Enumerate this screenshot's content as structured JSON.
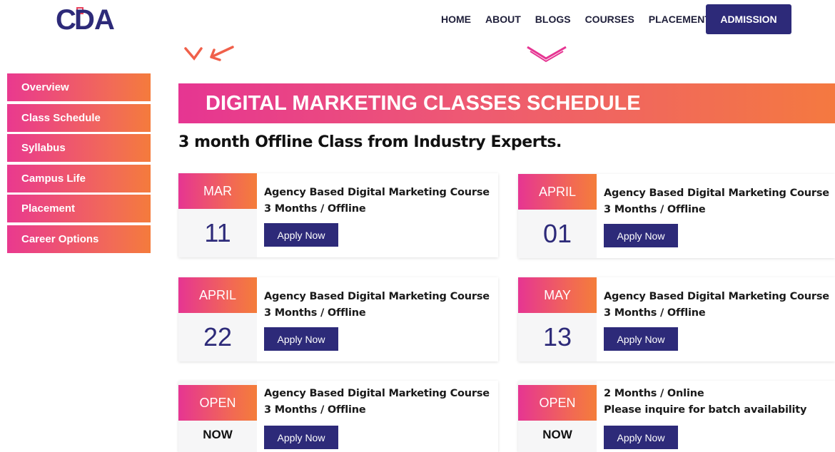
{
  "header": {
    "logo_text": "CDA",
    "nav": [
      "HOME",
      "ABOUT",
      "BLOGS",
      "COURSES",
      "PLACEMENT"
    ],
    "admission_label": "ADMISSION"
  },
  "sidebar": {
    "items": [
      {
        "label": "Overview"
      },
      {
        "label": "Class Schedule"
      },
      {
        "label": "Syllabus"
      },
      {
        "label": "Campus Life"
      },
      {
        "label": "Placement"
      },
      {
        "label": "Career Options"
      }
    ]
  },
  "main": {
    "title": "DIGITAL MARKETING CLASSES SCHEDULE",
    "subtitle": "3 month Offline Class from Industry Experts.",
    "cards": [
      {
        "month": "MAR",
        "day": "11",
        "line1": "Agency Based Digital Marketing Course",
        "line2": "3 Months / Offline",
        "button": "Apply Now"
      },
      {
        "month": "APRIL",
        "day": "01",
        "line1": "Agency Based Digital Marketing Course",
        "line2": "3 Months / Offline",
        "button": "Apply Now"
      },
      {
        "month": "APRIL",
        "day": "22",
        "line1": "Agency Based Digital Marketing Course",
        "line2": "3 Months / Offline",
        "button": "Apply Now"
      },
      {
        "month": "MAY",
        "day": "13",
        "line1": "Agency Based Digital Marketing Course",
        "line2": "3 Months / Offline",
        "button": "Apply Now"
      },
      {
        "month": "OPEN",
        "day": "NOW",
        "line1": "Agency Based Digital Marketing Course",
        "line2": "3 Months / Offline",
        "button": "Apply Now"
      },
      {
        "month": "OPEN",
        "day": "NOW",
        "line1": "2 Months / Online",
        "line2": "Please inquire for batch availability",
        "button": "Apply Now"
      }
    ]
  },
  "colors": {
    "brand_navy": "#2d2a79",
    "gradient_pink": "#e63592",
    "gradient_orange": "#f47940"
  }
}
